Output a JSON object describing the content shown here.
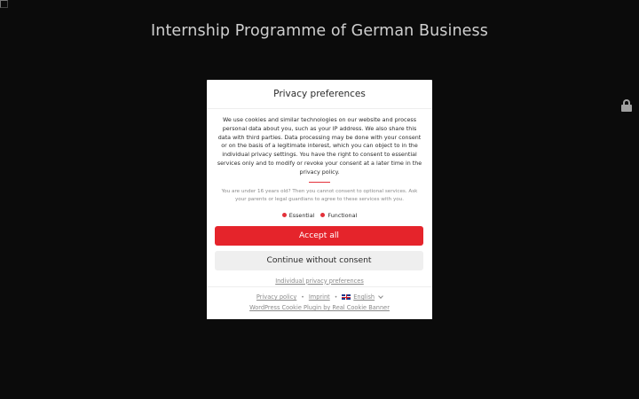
{
  "page": {
    "title": "Internship Programme of German Business"
  },
  "dialog": {
    "title": "Privacy preferences",
    "description": "We use cookies and similar technologies on our website and process personal data about you, such as your IP address. We also share this data with third parties. Data processing may be done with your consent or on the basis of a legitimate interest, which you can object to in the individual privacy settings. You have the right to consent to essential services only and to modify or revoke your consent at a later time in the privacy policy.",
    "age_notice": "You are under 16 years old? Then you cannot consent to optional services. Ask your parents or legal guardians to agree to these services with you.",
    "groups": [
      "Essential",
      "Functional"
    ],
    "accept_all_label": "Accept all",
    "continue_label": "Continue without consent",
    "individual_label": "Individual privacy preferences",
    "footer": {
      "privacy_policy": "Privacy policy",
      "imprint": "Imprint",
      "language": "English",
      "plugin_credit": "WordPress Cookie Plugin by Real Cookie Banner"
    }
  },
  "colors": {
    "accent": "#e5242b",
    "background": "#0b0b0b"
  },
  "icons": [
    "broken-image-icon",
    "lock-icon",
    "uk-flag-icon",
    "chevron-down-icon"
  ]
}
